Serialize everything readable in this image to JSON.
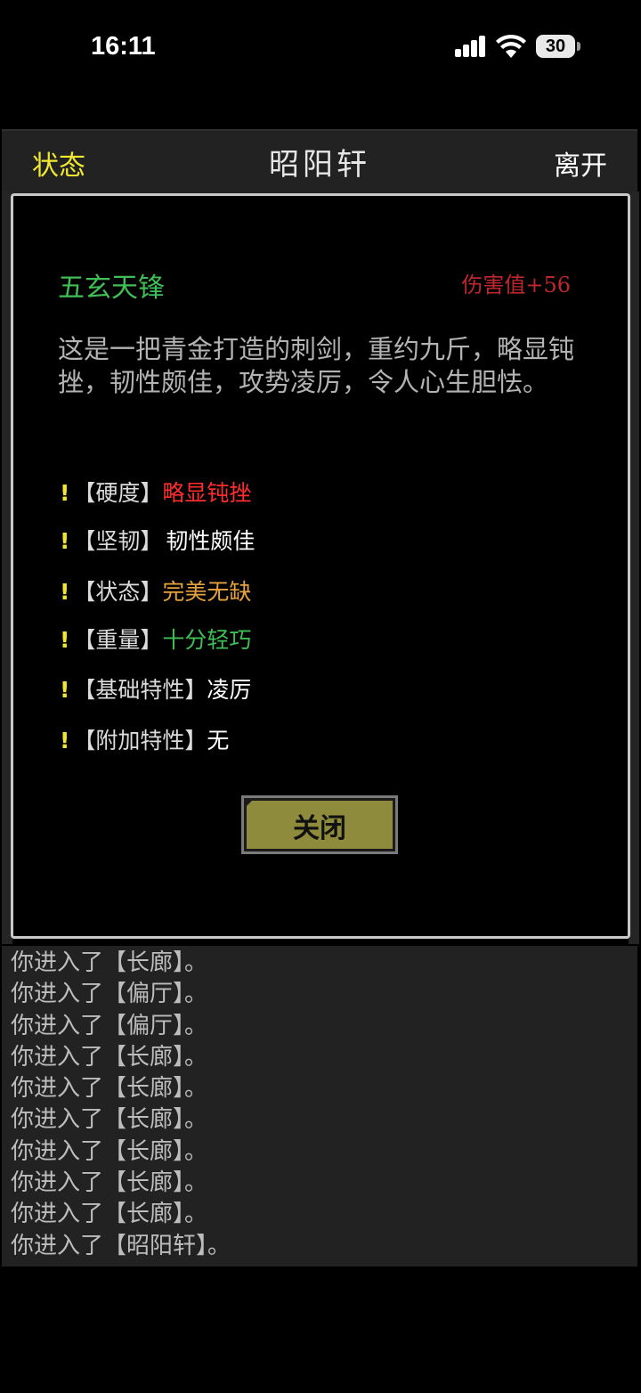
{
  "status_bar": {
    "time": "16:11",
    "battery": "30"
  },
  "header": {
    "status_button": "状态",
    "title": "昭阳轩",
    "leave_button": "离开"
  },
  "item": {
    "name": "五玄天锋",
    "damage": "伤害值+56",
    "description": "这是一把青金打造的刺剑，重约九斤，略显钝挫，韧性颇佳，攻势凌厉，令人心生胆怯。",
    "attributes": [
      {
        "mark": "!",
        "label": "【硬度】",
        "value": "略显钝挫",
        "color": "#ff2d2d"
      },
      {
        "mark": "!",
        "label": "【坚韧】",
        "value": "韧性颇佳",
        "color": "#ffffff"
      },
      {
        "mark": "!",
        "label": "【状态】",
        "value": "完美无缺",
        "color": "#e6a23c"
      },
      {
        "mark": "!",
        "label": "【重量】",
        "value": "十分轻巧",
        "color": "#3fbf55"
      },
      {
        "mark": "!",
        "label": "【基础特性】",
        "value": "凌厉",
        "color": "#ffffff"
      },
      {
        "mark": "!",
        "label": "【附加特性】",
        "value": "无",
        "color": "#ffffff"
      }
    ],
    "close_button": "关闭"
  },
  "log": [
    "你进入了【长廊】。",
    "你进入了【偏厅】。",
    "你进入了【偏厅】。",
    "你进入了【长廊】。",
    "你进入了【长廊】。",
    "你进入了【长廊】。",
    "你进入了【长廊】。",
    "你进入了【长廊】。",
    "你进入了【长廊】。",
    "你进入了【昭阳轩】。"
  ]
}
